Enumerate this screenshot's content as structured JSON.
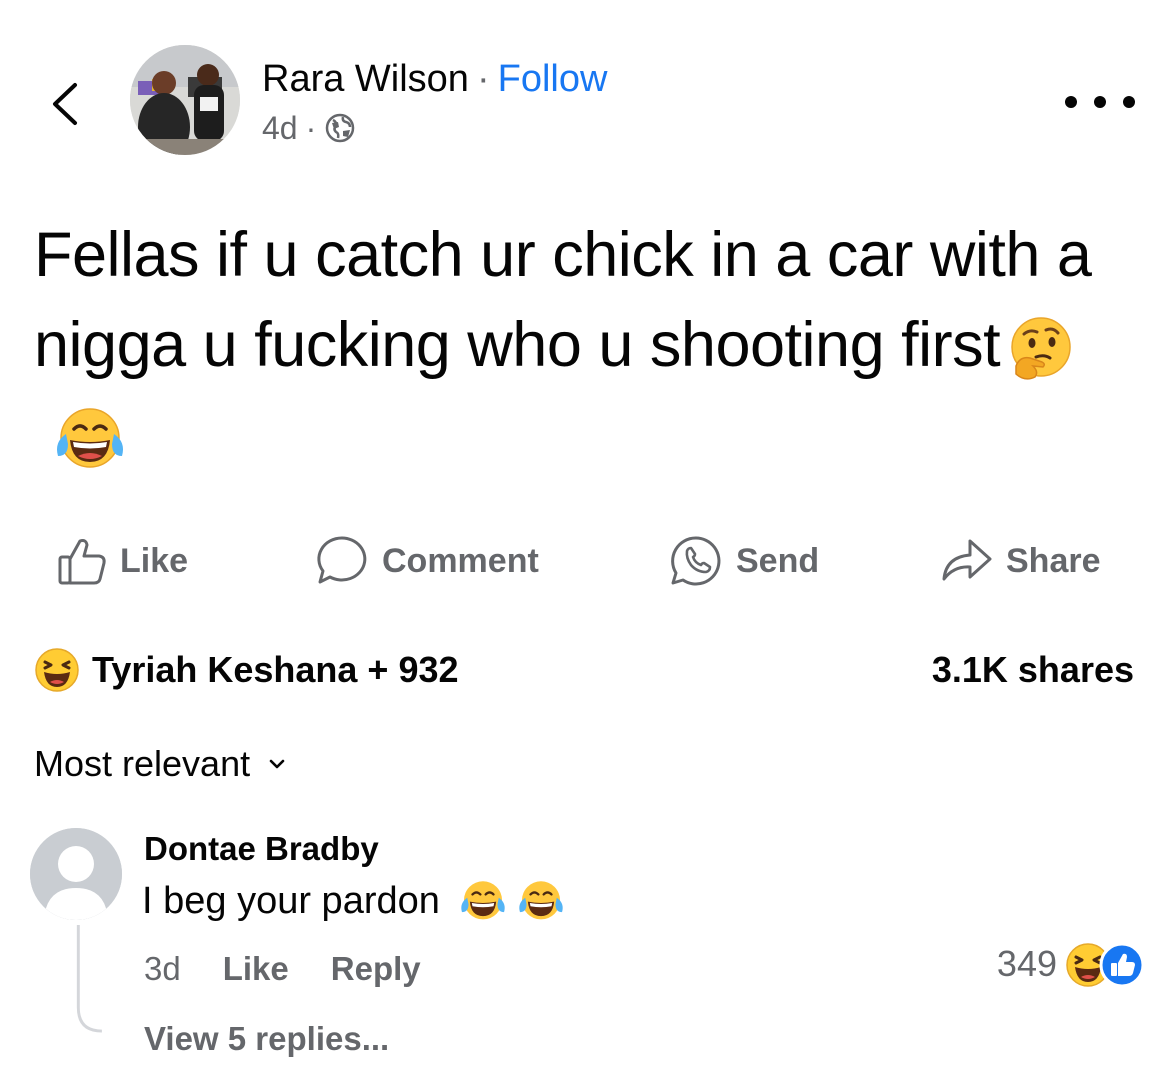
{
  "header": {
    "author_name": "Rara Wilson",
    "separator": "·",
    "follow_label": "Follow",
    "timestamp": "4d",
    "meta_separator": "·",
    "audience_icon": "globe-icon",
    "back_icon": "chevron-left-icon",
    "more_icon": "more-horizontal-icon"
  },
  "post": {
    "text": "Fellas if u catch ur chick in a car with a nigga u fucking who u shooting first",
    "emojis": [
      "thinking-face-emoji",
      "tears-of-joy-emoji"
    ]
  },
  "actions": {
    "like_label": "Like",
    "comment_label": "Comment",
    "send_label": "Send",
    "share_label": "Share"
  },
  "reactions": {
    "summary": "Tyriah Keshana + 932",
    "reaction_icon": "haha-reaction-icon",
    "shares": "3.1K shares"
  },
  "sort": {
    "label": "Most relevant",
    "icon": "chevron-down-icon"
  },
  "comment": {
    "author": "Dontae Bradby",
    "text": "I beg your pardon",
    "emojis": [
      "tears-of-joy-emoji",
      "tears-of-joy-emoji"
    ],
    "time": "3d",
    "like_label": "Like",
    "reply_label": "Reply",
    "reaction_count": "349",
    "reaction_icons": [
      "haha-reaction-icon",
      "like-reaction-icon"
    ],
    "view_replies": "View 5 replies..."
  },
  "colors": {
    "text_primary": "#050505",
    "text_secondary": "#65676b",
    "link_blue": "#1877f2",
    "emoji_yellow": "#ffcc33",
    "like_blue": "#1877f2"
  }
}
